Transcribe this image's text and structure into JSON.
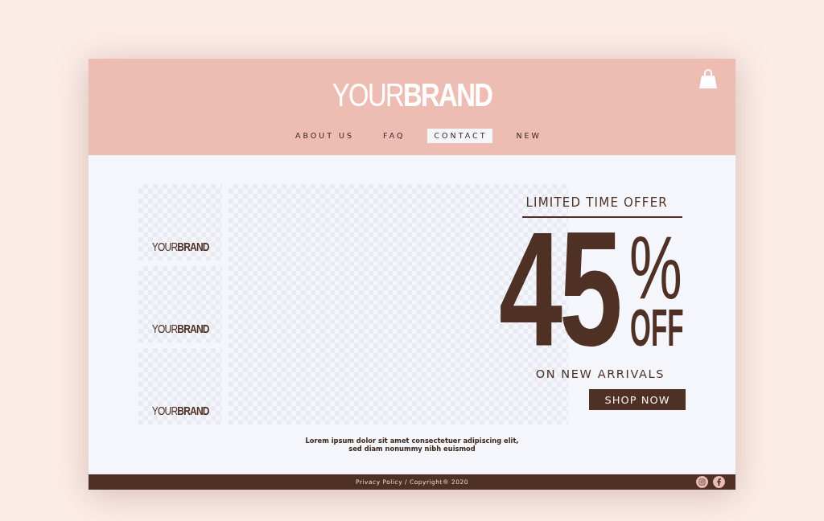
{
  "header": {
    "brand": "YOUR**BRAND**",
    "nav": [
      {
        "label": "ABOUT US",
        "selected": false
      },
      {
        "label": "FAQ",
        "selected": false
      },
      {
        "label": "CONTACT",
        "selected": true
      },
      {
        "label": "NEW",
        "selected": false
      }
    ]
  },
  "gallery": {
    "thumbnails": [
      {
        "brand": "YOUR**BRAND**"
      },
      {
        "brand": "YOUR**BRAND**"
      },
      {
        "brand": "YOUR**BRAND**"
      }
    ]
  },
  "offer": {
    "eyebrow": "LIMITED TIME OFFER",
    "amount": "45",
    "percent": "%",
    "off": "OFF",
    "subtitle": "ON NEW ARRIVALS",
    "button": "SHOP NOW"
  },
  "caption": "Lorem ipsum dolor sit amet consectetuer adipiscing elit, sed diam nonummy nibh euismod",
  "footer": {
    "text": "Privacy Policy / Copyright® 2020"
  }
}
